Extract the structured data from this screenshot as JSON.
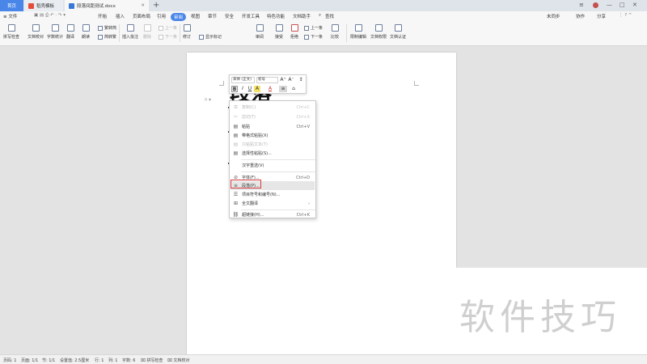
{
  "tabs": {
    "home": "首页",
    "template": "稻壳模板",
    "doc": "段落间距测试.docx",
    "add": "+"
  },
  "window": {
    "menu_icon": "≡",
    "min": "—",
    "max": "□",
    "close": "✕"
  },
  "menubar": {
    "file": "≡ 文件",
    "items": [
      "开始",
      "插入",
      "页面布局",
      "引用",
      "审阅",
      "视图",
      "章节",
      "安全",
      "开发工具",
      "特色功能",
      "文档助手"
    ],
    "search": "查找",
    "right": [
      "未同步",
      "协作",
      "分享"
    ]
  },
  "ribbon": {
    "spellcheck": "拼写检查",
    "doc_proof": "文档校对",
    "word_count": "字数统计",
    "translate": "翻译",
    "read_aloud": "朗读",
    "simp_to_trad": "繁转简",
    "trad_to_simp": "简转繁",
    "insert_comment": "插入批注",
    "delete": "删除",
    "prev_comment": "上一条",
    "next_comment": "下一条",
    "track_changes": "修订",
    "show_markup_state": "显示标记的最终状态",
    "show_markup": "显示标记",
    "review": "审阅",
    "accept": "接受",
    "reject": "拒绝",
    "prev_change": "上一条",
    "next_change": "下一条",
    "compare": "比较",
    "restrict_edit": "限制编辑",
    "doc_permission": "文档权限",
    "doc_cert": "文档认证"
  },
  "document": {
    "heading": "段落"
  },
  "minibar": {
    "font_name": "宋体 (正文)",
    "font_size": "初号",
    "grow": "A⁺",
    "shrink": "A⁻",
    "bold": "B",
    "italic": "I",
    "underline": "U",
    "highlight": "A",
    "color": "A"
  },
  "context_menu": [
    {
      "label": "复制(C)",
      "shortcut": "Ctrl+C",
      "icon": "copy-icon",
      "disabled": true
    },
    {
      "label": "剪切(T)",
      "shortcut": "Ctrl+X",
      "icon": "scissors-icon",
      "disabled": true
    },
    {
      "label": "粘贴",
      "shortcut": "Ctrl+V",
      "icon": "paste-icon",
      "disabled": false
    },
    {
      "label": "带格式粘贴(X)",
      "shortcut": "",
      "icon": "paste-format-icon",
      "disabled": false
    },
    {
      "label": "只粘贴文本(T)",
      "shortcut": "",
      "icon": "paste-text-icon",
      "disabled": true
    },
    {
      "label": "选择性粘贴(S)...",
      "shortcut": "",
      "icon": "paste-special-icon",
      "disabled": false
    },
    {
      "label": "汉字重选(V)",
      "shortcut": "",
      "icon": "",
      "disabled": false
    },
    {
      "label": "字体(F)...",
      "shortcut": "Ctrl+D",
      "icon": "font-icon",
      "disabled": false
    },
    {
      "label": "段落(P)...",
      "shortcut": "",
      "icon": "paragraph-icon",
      "disabled": false
    },
    {
      "label": "项目符号和编号(N)...",
      "shortcut": "",
      "icon": "list-icon",
      "disabled": false
    },
    {
      "label": "全文翻译",
      "shortcut": "",
      "icon": "translate-icon",
      "disabled": false
    },
    {
      "label": "超链接(H)...",
      "shortcut": "Ctrl+K",
      "icon": "link-icon",
      "disabled": false
    }
  ],
  "watermark": "软件技巧",
  "statusbar": {
    "page_num": "页码: 1",
    "pages": "页面: 1/1",
    "section": "节: 1/1",
    "setting": "设置值: 2.5厘米",
    "row": "行: 1",
    "col": "列: 1",
    "words": "字数: 6",
    "spell": "拼写检查",
    "proof": "文档校对"
  }
}
